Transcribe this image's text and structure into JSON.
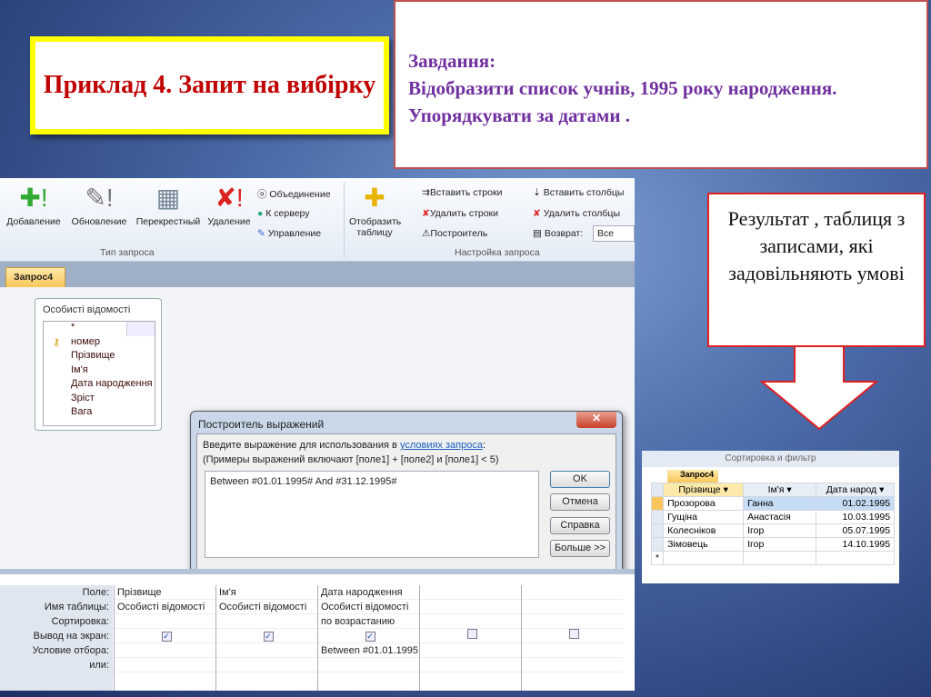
{
  "slide": {
    "title": "Приклад 4. Запит на вибірку",
    "task_heading": "Завдання:",
    "task_text": "Відобразити список  учнів, 1995 року народження.  Упорядкувати за датами .",
    "result_text": "Результат , таблиця з записами, які задовільняють умові",
    "colors": {
      "title": "#c00000",
      "title_border": "#ffff00",
      "task": "#7030a0",
      "callout_border": "#e02020"
    }
  },
  "ribbon": {
    "buttons": [
      "Добавление",
      "Обновление",
      "Перекрестный",
      "Удаление"
    ],
    "small1": [
      "Объединение",
      "К серверу",
      "Управление"
    ],
    "show_table": "Отобразить таблицу",
    "small2": [
      "Вставить строки",
      "Удалить строки",
      "Построитель"
    ],
    "small3": [
      "Вставить столбцы",
      "Удалить столбцы",
      "Возврат:"
    ],
    "return_value": "Все",
    "group1": "Тип запроса",
    "group2": "Настройка запроса"
  },
  "tab": "Запрос4",
  "table_box": {
    "title": "Особисті відомості",
    "fields": [
      "*",
      "номер",
      "Прізвище",
      "Ім'я",
      "Дата народження",
      "Зріст",
      "Вага"
    ]
  },
  "dialog": {
    "title": "Построитель выражений",
    "line1_prefix": "Введите выражение для использования в ",
    "line1_link": "условиях запроса",
    "line1_suffix": ":",
    "line2": "(Примеры выражений включают [поле1] + [поле2] и [поле1] < 5)",
    "expression": "Between #01.01.1995# And #31.12.1995#",
    "buttons": [
      "OK",
      "Отмена",
      "Справка",
      "Больше >>"
    ]
  },
  "grid": {
    "row_labels": [
      "Поле:",
      "Имя таблицы:",
      "Сортировка:",
      "Вывод на экран:",
      "Условие отбора:",
      "или:"
    ],
    "columns": [
      {
        "field": "Прізвище",
        "table": "Особисті відомості",
        "sort": "",
        "show": true,
        "criteria": ""
      },
      {
        "field": "Ім'я",
        "table": "Особисті відомості",
        "sort": "",
        "show": true,
        "criteria": ""
      },
      {
        "field": "Дата народження",
        "table": "Особисті відомості",
        "sort": "по возрастанию",
        "show": true,
        "criteria": "Between #01.01.1995"
      },
      {
        "field": "",
        "table": "",
        "sort": "",
        "show": false,
        "criteria": ""
      },
      {
        "field": "",
        "table": "",
        "sort": "",
        "show": false,
        "criteria": ""
      }
    ]
  },
  "result": {
    "group_label": "Сортировка и фильтр",
    "tab": "Запрос4",
    "headers": [
      "Прізвище",
      "Ім'я",
      "Дата народ"
    ],
    "rows": [
      [
        "Прозорова",
        "Ганна",
        "01.02.1995"
      ],
      [
        "Гущіна",
        "Анастасія",
        "10.03.1995"
      ],
      [
        "Колесніков",
        "Ігор",
        "05.07.1995"
      ],
      [
        "Зімовець",
        "Ігор",
        "14.10.1995"
      ]
    ],
    "new_row_marker": "*"
  }
}
